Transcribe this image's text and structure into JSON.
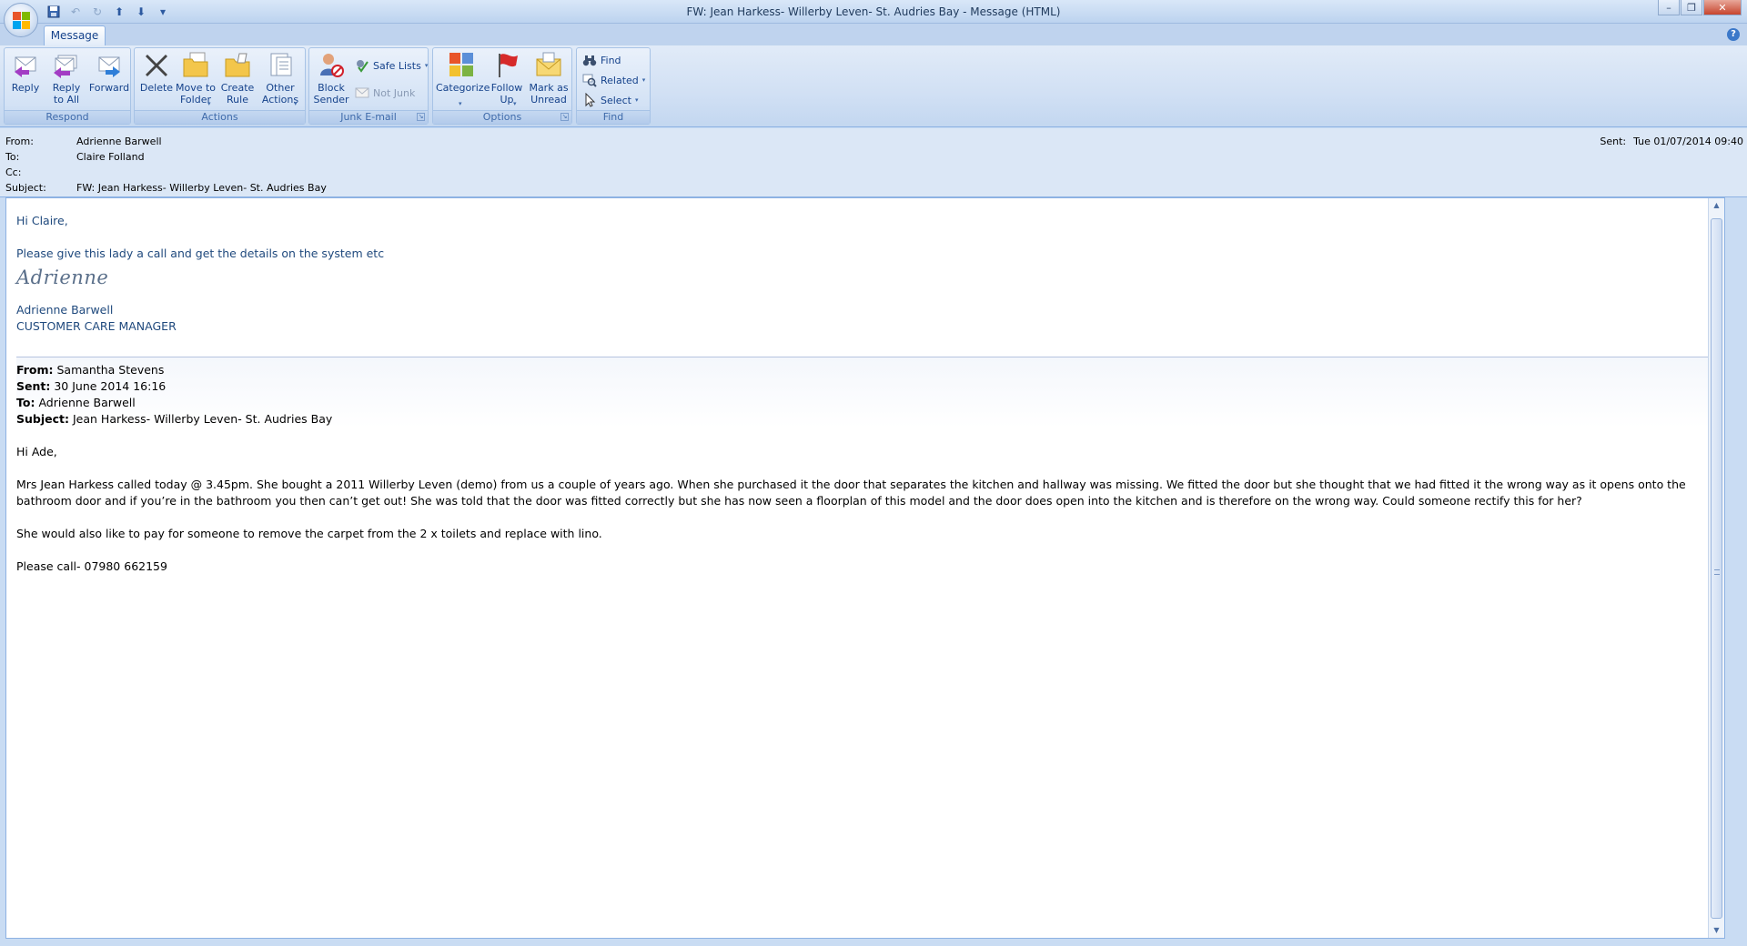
{
  "window": {
    "title": "FW: Jean Harkess- Willerby Leven- St. Audries Bay - Message (HTML)",
    "minimize": "–",
    "restore": "❐",
    "close": "✕"
  },
  "qat": {
    "customize": "▾"
  },
  "tabs": [
    {
      "label": "Message"
    }
  ],
  "help": "?",
  "ribbon": {
    "respond": {
      "label": "Respond",
      "reply": "Reply",
      "reply_all": "Reply\nto All",
      "forward": "Forward"
    },
    "actions": {
      "label": "Actions",
      "delete": "Delete",
      "move_to_folder": "Move to\nFolder",
      "create_rule": "Create\nRule",
      "other_actions": "Other\nActions"
    },
    "junk": {
      "label": "Junk E-mail",
      "block_sender": "Block\nSender",
      "safe_lists": "Safe Lists",
      "not_junk": "Not Junk"
    },
    "options": {
      "label": "Options",
      "categorize": "Categorize",
      "follow_up": "Follow\nUp",
      "mark_unread": "Mark as\nUnread"
    },
    "find": {
      "label": "Find",
      "find": "Find",
      "related": "Related",
      "select": "Select"
    }
  },
  "headers": {
    "from_label": "From:",
    "from": "Adrienne Barwell",
    "to_label": "To:",
    "to": "Claire Folland",
    "cc_label": "Cc:",
    "cc": "",
    "subject_label": "Subject:",
    "subject": "FW: Jean Harkess- Willerby Leven- St. Audries Bay",
    "sent_label": "Sent:",
    "sent": "Tue 01/07/2014 09:40"
  },
  "body": {
    "greeting": "Hi Claire,",
    "line1": "Please give this lady a call and get the details on the system etc",
    "signature_script": "Adrienne",
    "sig_name": "Adrienne Barwell",
    "sig_title": "CUSTOMER CARE MANAGER",
    "fwd": {
      "from_label": "From:",
      "from": "Samantha Stevens",
      "sent_label": "Sent:",
      "sent": "30 June 2014 16:16",
      "to_label": "To:",
      "to": "Adrienne Barwell",
      "subject_label": "Subject:",
      "subject": "Jean Harkess- Willerby Leven- St. Audries Bay"
    },
    "fwd_greeting": "Hi Ade,",
    "para1": "Mrs Jean Harkess called today @ 3.45pm. She bought a 2011 Willerby Leven (demo) from us a couple of years ago. When she purchased it the door that separates the kitchen and hallway was missing. We fitted the door but she thought that we had fitted it the wrong way as it opens onto the bathroom door and if you’re in the bathroom you then can’t get out! She was told that the door was fitted correctly but she has now seen a floorplan of this model and the door does open into the kitchen and is therefore on the wrong way. Could someone rectify this for her?",
    "para2": "She would also like to pay for someone to remove the carpet from the 2 x toilets and replace with lino.",
    "para3": "Please call- 07980 662159"
  }
}
